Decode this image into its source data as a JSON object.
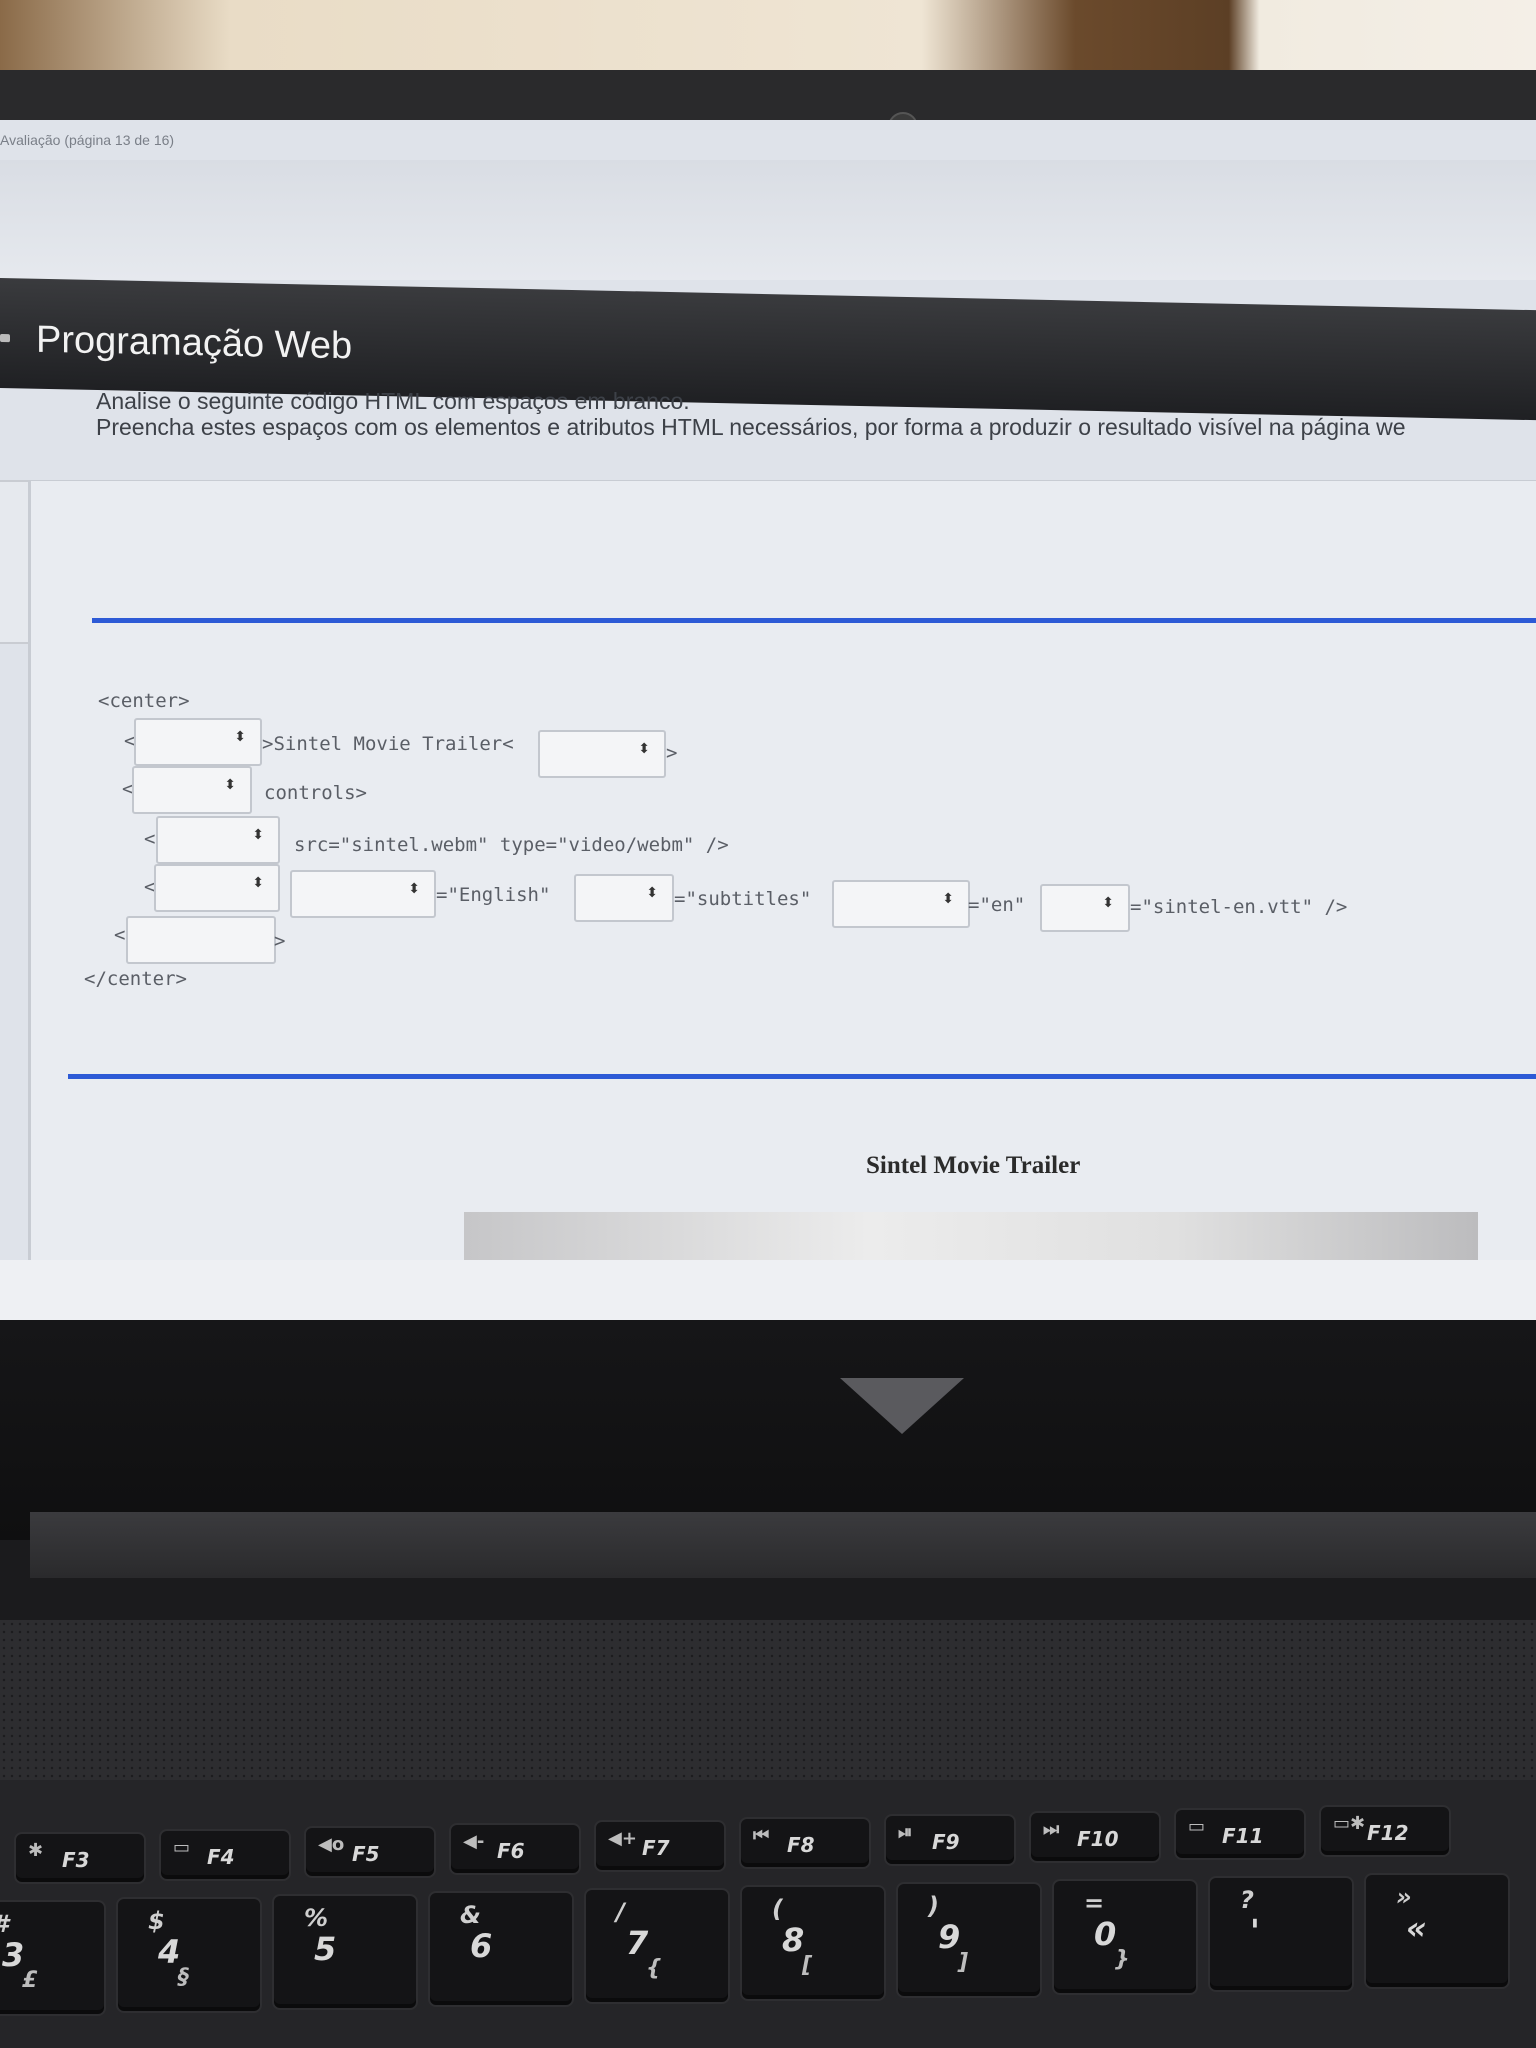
{
  "browser": {
    "tab_title": "Avaliação (página 13 de 16)"
  },
  "header": {
    "title": "Programação Web"
  },
  "question": {
    "line1": "Analise o seguinte código HTML com espaços em branco.",
    "line2": "Preencha estes espaços com os elementos e atributos HTML necessários, por forma a produzir o resultado visível na página we"
  },
  "code": {
    "center_open": "<center>",
    "lt": "<",
    "gt": ">",
    "line1_mid": ">Sintel Movie Trailer<",
    "line2_rest": "controls>",
    "line3_rest": "src=\"sintel.webm\" type=\"video/webm\" />",
    "line4_a": "=\"English\"",
    "line4_b": "=\"subtitles\"",
    "line4_c": "=\"en\"",
    "line4_d": "=\"sintel-en.vtt\" />",
    "center_close": "</center>",
    "select_arrow": "⬍"
  },
  "result": {
    "title": "Sintel Movie Trailer"
  },
  "keyboard": {
    "fkeys": [
      {
        "fn": "F3",
        "sym": "✱"
      },
      {
        "fn": "F4",
        "sym": "▭"
      },
      {
        "fn": "F5",
        "sym": "◀o"
      },
      {
        "fn": "F6",
        "sym": "◀-"
      },
      {
        "fn": "F7",
        "sym": "◀+"
      },
      {
        "fn": "F8",
        "sym": "⏮"
      },
      {
        "fn": "F9",
        "sym": "⏯"
      },
      {
        "fn": "F10",
        "sym": "⏭"
      },
      {
        "fn": "F11",
        "sym": "▭"
      },
      {
        "fn": "F12",
        "sym": "▭✱"
      }
    ],
    "numkeys": [
      {
        "top": "#",
        "main": "3",
        "sub": "£"
      },
      {
        "top": "$",
        "main": "4",
        "sub": "§"
      },
      {
        "top": "%",
        "main": "5",
        "sub": ""
      },
      {
        "top": "&",
        "main": "6",
        "sub": ""
      },
      {
        "top": "/",
        "main": "7",
        "sub": "{"
      },
      {
        "top": "(",
        "main": "8",
        "sub": "["
      },
      {
        "top": ")",
        "main": "9",
        "sub": "]"
      },
      {
        "top": "=",
        "main": "0",
        "sub": "}"
      },
      {
        "top": "?",
        "main": "'",
        "sub": ""
      },
      {
        "top": "»",
        "main": "«",
        "sub": ""
      }
    ]
  }
}
